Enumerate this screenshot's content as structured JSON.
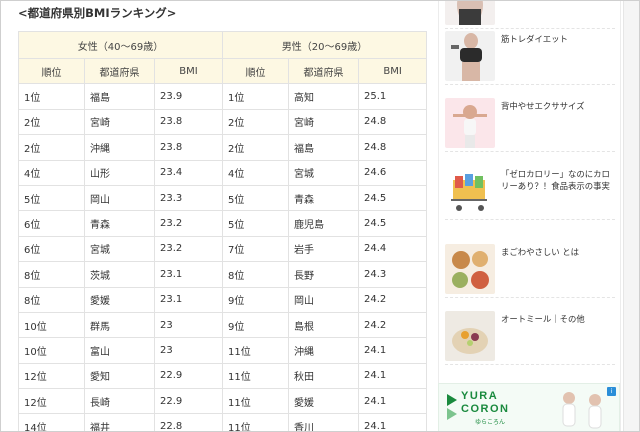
{
  "heading": "<都道府県別BMIランキング>",
  "table": {
    "female_header": "女性（40〜69歳）",
    "male_header": "男性（20〜69歳）",
    "col_rank": "順位",
    "col_pref": "都道府県",
    "col_bmi": "BMI",
    "rows": [
      {
        "f_rank": "1位",
        "f_pref": "福島",
        "f_bmi": "23.9",
        "m_rank": "1位",
        "m_pref": "高知",
        "m_bmi": "25.1"
      },
      {
        "f_rank": "2位",
        "f_pref": "宮崎",
        "f_bmi": "23.8",
        "m_rank": "2位",
        "m_pref": "宮崎",
        "m_bmi": "24.8"
      },
      {
        "f_rank": "2位",
        "f_pref": "沖縄",
        "f_bmi": "23.8",
        "m_rank": "2位",
        "m_pref": "福島",
        "m_bmi": "24.8"
      },
      {
        "f_rank": "4位",
        "f_pref": "山形",
        "f_bmi": "23.4",
        "m_rank": "4位",
        "m_pref": "宮城",
        "m_bmi": "24.6"
      },
      {
        "f_rank": "5位",
        "f_pref": "岡山",
        "f_bmi": "23.3",
        "m_rank": "5位",
        "m_pref": "青森",
        "m_bmi": "24.5"
      },
      {
        "f_rank": "6位",
        "f_pref": "青森",
        "f_bmi": "23.2",
        "m_rank": "5位",
        "m_pref": "鹿児島",
        "m_bmi": "24.5"
      },
      {
        "f_rank": "6位",
        "f_pref": "宮城",
        "f_bmi": "23.2",
        "m_rank": "7位",
        "m_pref": "岩手",
        "m_bmi": "24.4"
      },
      {
        "f_rank": "8位",
        "f_pref": "茨城",
        "f_bmi": "23.1",
        "m_rank": "8位",
        "m_pref": "長野",
        "m_bmi": "24.3"
      },
      {
        "f_rank": "8位",
        "f_pref": "愛媛",
        "f_bmi": "23.1",
        "m_rank": "9位",
        "m_pref": "岡山",
        "m_bmi": "24.2"
      },
      {
        "f_rank": "10位",
        "f_pref": "群馬",
        "f_bmi": "23",
        "m_rank": "9位",
        "m_pref": "島根",
        "m_bmi": "24.2"
      },
      {
        "f_rank": "10位",
        "f_pref": "富山",
        "f_bmi": "23",
        "m_rank": "11位",
        "m_pref": "沖縄",
        "m_bmi": "24.1"
      },
      {
        "f_rank": "12位",
        "f_pref": "愛知",
        "f_bmi": "22.9",
        "m_rank": "11位",
        "m_pref": "秋田",
        "m_bmi": "24.1"
      },
      {
        "f_rank": "12位",
        "f_pref": "長崎",
        "f_bmi": "22.9",
        "m_rank": "11位",
        "m_pref": "愛媛",
        "m_bmi": "24.1"
      },
      {
        "f_rank": "14位",
        "f_pref": "福井",
        "f_bmi": "22.8",
        "m_rank": "11位",
        "m_pref": "香川",
        "m_bmi": "24.1"
      }
    ]
  },
  "sidebar": {
    "items": [
      {
        "label": "筋トレダイエット"
      },
      {
        "label": "背中やせエクササイズ"
      },
      {
        "label": "「ゼロカロリー」なのにカロリーあり？！食品表示の事実"
      },
      {
        "label": "まごわやさしい とは"
      },
      {
        "label": "オートミール｜その他"
      }
    ]
  },
  "ad": {
    "brand_line1": "YURA",
    "brand_line2": "CORON",
    "brand_kana": "ゆらころん",
    "info_glyph": "i",
    "accent_color": "#1a8a3e"
  }
}
